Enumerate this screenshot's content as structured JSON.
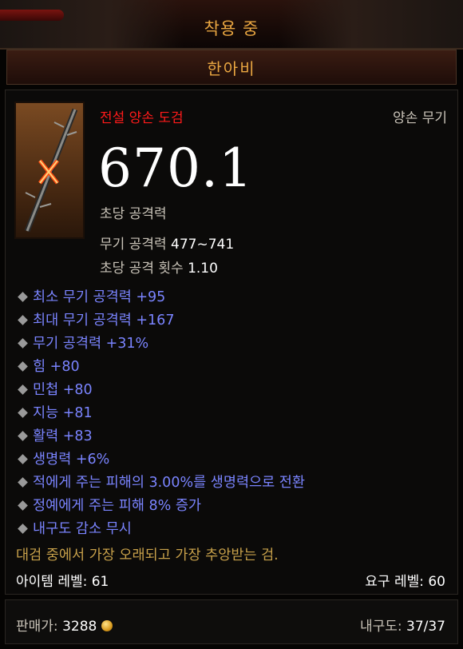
{
  "header": {
    "equipped_label": "착용 중",
    "item_name": "한아비"
  },
  "item": {
    "type": "전설 양손 도검",
    "slot": "양손 무기",
    "dps": "670.1",
    "dps_label": "초당 공격력",
    "weapon_damage_label": "무기 공격력",
    "weapon_damage_value": "477~741",
    "attack_speed_label": "초당 공격 횟수",
    "attack_speed_value": "1.10",
    "colors": {
      "legendary": "#ff1a1a",
      "affix": "#7a84ff",
      "flavor": "#c7a04a",
      "title": "#e9a641"
    }
  },
  "affixes": [
    "최소 무기 공격력 +95",
    "최대 무기 공격력 +167",
    "무기 공격력 +31%",
    "힘 +80",
    "민첩 +80",
    "지능 +81",
    "활력 +83",
    "생명력 +6%",
    "적에게 주는 피해의 3.00%를 생명력으로 전환",
    "정예에게 주는 피해 8% 증가",
    "내구도 감소 무시"
  ],
  "flavor_text": "대검 중에서 가장 오래되고 가장 추앙받는 검.",
  "item_level": "아이템 레벨: 61",
  "required_level": "요구 레벨: 60",
  "footer": {
    "price_label": "판매가:",
    "price_value": "3288",
    "durability_label": "내구도:",
    "durability_value": "37/37"
  }
}
